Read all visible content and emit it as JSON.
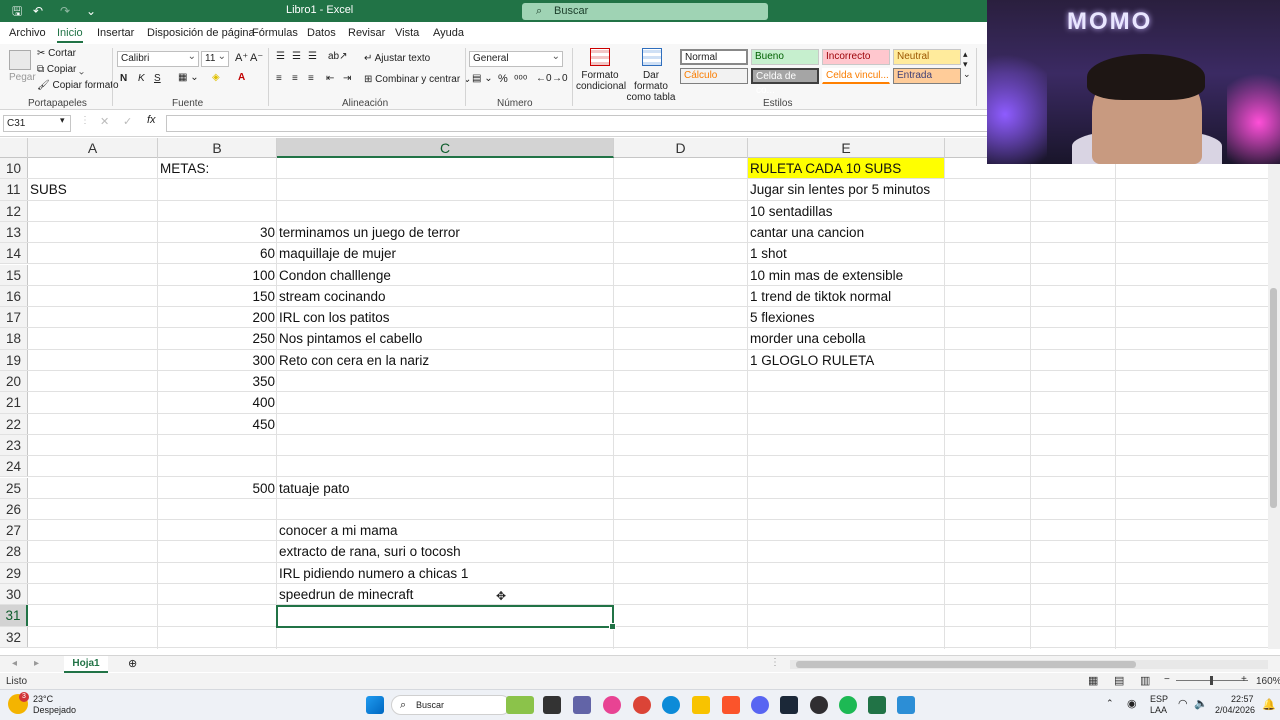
{
  "titlebar": {
    "title": "Libro1 - Excel",
    "search_placeholder": "Buscar"
  },
  "tabs": [
    "Archivo",
    "Inicio",
    "Insertar",
    "Disposición de página",
    "Fórmulas",
    "Datos",
    "Revisar",
    "Vista",
    "Ayuda"
  ],
  "ribbon": {
    "portapapeles": {
      "pegar": "Pegar",
      "cortar": "Cortar",
      "copiar": "Copiar",
      "copiar_formato": "Copiar formato",
      "label": "Portapapeles"
    },
    "fuente": {
      "font": "Calibri",
      "size": "11",
      "bold": "N",
      "italic": "K",
      "underline": "S",
      "label": "Fuente"
    },
    "alineacion": {
      "ajustar": "Ajustar texto",
      "combinar": "Combinar y centrar",
      "label": "Alineación"
    },
    "numero": {
      "format": "General",
      "label": "Número"
    },
    "estilos": {
      "formato_condicional": "Formato condicional",
      "formato_tabla": "Dar formato como tabla",
      "label": "Estilos",
      "normal": "Normal",
      "bueno": "Bueno",
      "incorrecto": "Incorrecto",
      "neutral": "Neutral",
      "calculo": "Cálculo",
      "celda_co": "Celda de co...",
      "celda_vinc": "Celda vincul...",
      "entrada": "Entrada"
    }
  },
  "formula_bar": {
    "name_box": "C31",
    "value": ""
  },
  "columns": [
    "A",
    "B",
    "C",
    "D",
    "E"
  ],
  "rows": [
    {
      "n": "10",
      "a": "",
      "b": "METAS:",
      "b_align": "left",
      "c": "",
      "e": "RULETA CADA 10 SUBS"
    },
    {
      "n": "11",
      "a": "SUBS",
      "b": "",
      "c": "",
      "e": "Jugar sin lentes por 5 minutos"
    },
    {
      "n": "12",
      "a": "",
      "b": "",
      "c": "",
      "e": "10 sentadillas"
    },
    {
      "n": "13",
      "a": "",
      "b": "30",
      "c": "terminamos un juego de terror",
      "e": "cantar una cancion"
    },
    {
      "n": "14",
      "a": "",
      "b": "60",
      "c": "maquillaje de mujer",
      "e": "1 shot"
    },
    {
      "n": "15",
      "a": "",
      "b": "100",
      "c": "Condon challlenge",
      "e": "10 min mas de extensible"
    },
    {
      "n": "16",
      "a": "",
      "b": "150",
      "c": "stream cocinando",
      "e": "1 trend de tiktok normal"
    },
    {
      "n": "17",
      "a": "",
      "b": "200",
      "c": "IRL con los patitos",
      "e": "5 flexiones"
    },
    {
      "n": "18",
      "a": "",
      "b": "250",
      "c": "Nos pintamos el cabello",
      "e": "morder una cebolla"
    },
    {
      "n": "19",
      "a": "",
      "b": "300",
      "c": "Reto con cera en la nariz",
      "e": "1 GLOGLO RULETA"
    },
    {
      "n": "20",
      "a": "",
      "b": "350",
      "c": "",
      "e": ""
    },
    {
      "n": "21",
      "a": "",
      "b": "400",
      "c": "",
      "e": ""
    },
    {
      "n": "22",
      "a": "",
      "b": "450",
      "c": "",
      "e": ""
    },
    {
      "n": "23",
      "a": "",
      "b": "",
      "c": "",
      "e": ""
    },
    {
      "n": "24",
      "a": "",
      "b": "",
      "c": "",
      "e": ""
    },
    {
      "n": "25",
      "a": "",
      "b": "500",
      "c": "tatuaje pato",
      "e": ""
    },
    {
      "n": "26",
      "a": "",
      "b": "",
      "c": "",
      "e": ""
    },
    {
      "n": "27",
      "a": "",
      "b": "",
      "c": "conocer a mi mama",
      "e": ""
    },
    {
      "n": "28",
      "a": "",
      "b": "",
      "c": "extracto de rana, suri o tocosh",
      "e": ""
    },
    {
      "n": "29",
      "a": "",
      "b": "",
      "c": "IRL pidiendo numero a chicas 1",
      "e": ""
    },
    {
      "n": "30",
      "a": "",
      "b": "",
      "c": "speedrun de minecraft",
      "e": ""
    },
    {
      "n": "31",
      "a": "",
      "b": "",
      "c": "",
      "e": ""
    },
    {
      "n": "32",
      "a": "",
      "b": "",
      "c": "",
      "e": ""
    }
  ],
  "highlight_color": "#ffff00",
  "selected_cell": "C31",
  "sheet_tab": "Hoja1",
  "status": {
    "text": "Listo",
    "zoom": "160%"
  },
  "taskbar": {
    "weather_temp": "23°C",
    "weather_desc": "Despejado",
    "weather_badge": "3",
    "search": "Buscar",
    "lang1": "ESP",
    "lang2": "LAA",
    "time": "22:57",
    "date": "2/04/2026"
  },
  "webcam": {
    "neon_text": "MOMO"
  }
}
